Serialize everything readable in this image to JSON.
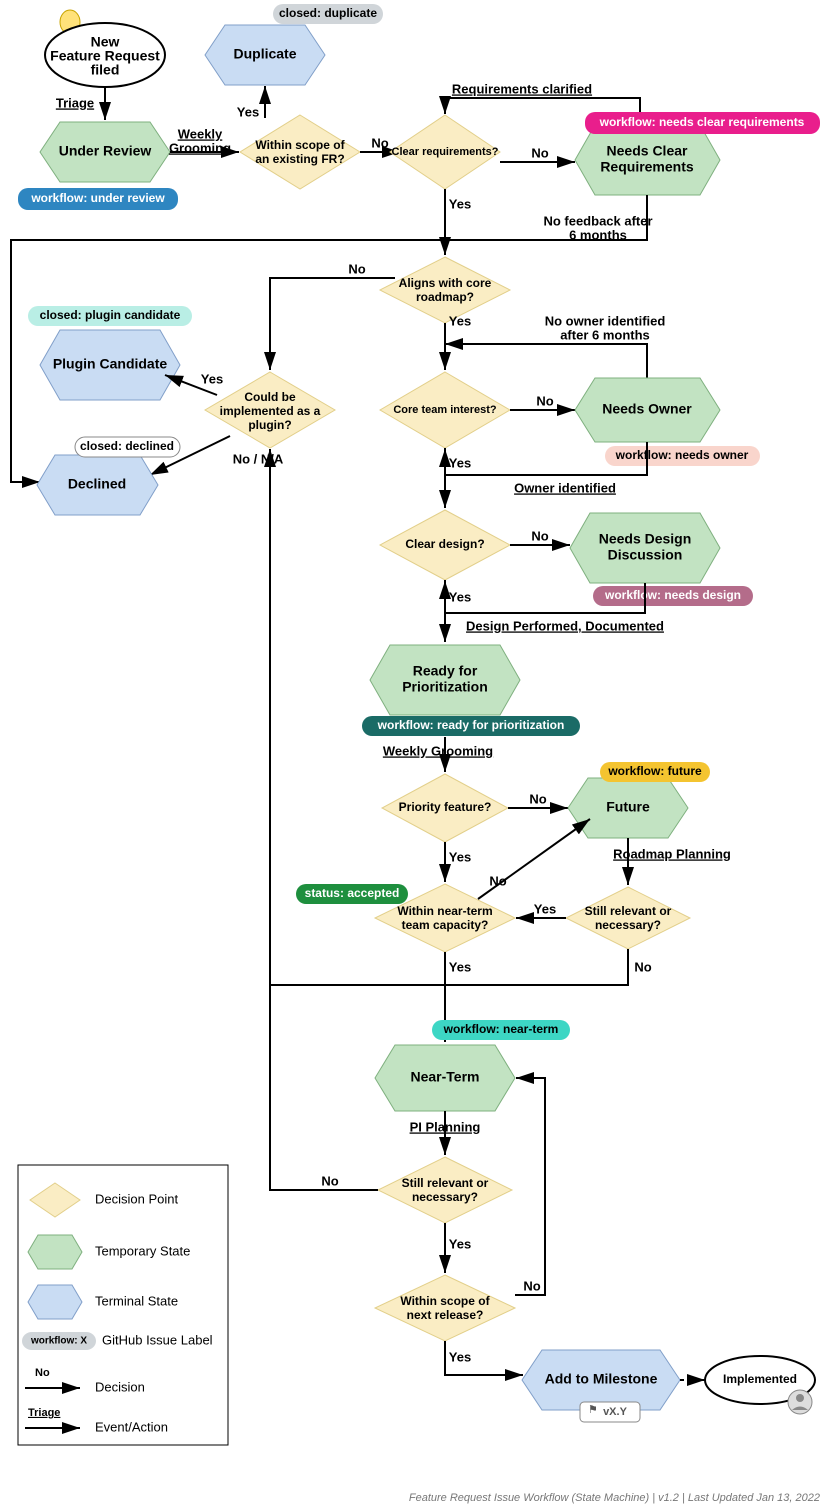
{
  "meta": {
    "title": "Feature Request Issue Workflow (State Machine)",
    "version": "v1.2",
    "last_updated": "Last Updated Jan 13, 2022",
    "footer_combined": "Feature Request Issue Workflow (State Machine) | v1.2 | Last Updated Jan 13, 2022"
  },
  "nodes": {
    "start": {
      "label_l1": "New",
      "label_l2": "Feature Request",
      "label_l3": "filed"
    },
    "under_review": {
      "label_l1": "Under Review"
    },
    "duplicate": {
      "label_l1": "Duplicate"
    },
    "within_scope_fr": {
      "label_l1": "Within scope of",
      "label_l2": "an existing FR?"
    },
    "clear_requirements": {
      "label_l1": "Clear requirements?"
    },
    "needs_clear_req": {
      "label_l1": "Needs Clear",
      "label_l2": "Requirements"
    },
    "aligns_roadmap": {
      "label_l1": "Aligns with core",
      "label_l2": "roadmap?"
    },
    "plugin_candidate": {
      "label_l1": "Plugin Candidate"
    },
    "could_plugin": {
      "label_l1": "Could be",
      "label_l2": "implemented as a",
      "label_l3": "plugin?"
    },
    "declined": {
      "label_l1": "Declined"
    },
    "core_team_interest": {
      "label_l1": "Core team interest?"
    },
    "needs_owner": {
      "label_l1": "Needs Owner"
    },
    "clear_design": {
      "label_l1": "Clear design?"
    },
    "needs_design": {
      "label_l1": "Needs Design",
      "label_l2": "Discussion"
    },
    "ready_prioritization": {
      "label_l1": "Ready for",
      "label_l2": "Prioritization"
    },
    "priority_feature": {
      "label_l1": "Priority feature?"
    },
    "future": {
      "label_l1": "Future"
    },
    "within_capacity": {
      "label_l1": "Within near-term",
      "label_l2": "team capacity?"
    },
    "still_relevant_1": {
      "label_l1": "Still relevant or",
      "label_l2": "necessary?"
    },
    "near_term": {
      "label_l1": "Near-Term"
    },
    "still_relevant_2": {
      "label_l1": "Still relevant or",
      "label_l2": "necessary?"
    },
    "within_next_release": {
      "label_l1": "Within scope of",
      "label_l2": "next release?"
    },
    "add_milestone": {
      "label_l1": "Add to Milestone"
    },
    "implemented": {
      "label_l1": "Implemented"
    },
    "milestone_tag": {
      "label_l1": "vX.Y"
    }
  },
  "badges": {
    "under_review": "workflow: under review",
    "closed_duplicate": "closed: duplicate",
    "needs_clear_req": "workflow: needs clear requirements",
    "plugin_candidate": "closed: plugin candidate",
    "closed_declined": "closed: declined",
    "needs_owner": "workflow: needs owner",
    "needs_design": "workflow: needs design",
    "ready_prioritization": "workflow: ready for prioritization",
    "future": "workflow: future",
    "status_accepted": "status: accepted",
    "near_term": "workflow: near-term"
  },
  "edges": {
    "triage": "Triage",
    "weekly_grooming_1": "Weekly",
    "weekly_grooming_1b": "Grooming",
    "yes": "Yes",
    "no": "No",
    "requirements_clarified": "Requirements clarified",
    "no_feedback_6mo": "No feedback after",
    "no_feedback_6mo_b": "6 months",
    "no_owner_6mo": "No owner identified",
    "no_owner_6mo_b": "after 6 months",
    "owner_identified": "Owner identified",
    "design_performed": "Design Performed, Documented",
    "weekly_grooming_2": "Weekly Grooming",
    "roadmap_planning": "Roadmap Planning",
    "pi_planning": "PI Planning",
    "no_na": "No / N/A"
  },
  "legend": {
    "decision_point": "Decision Point",
    "temporary_state": "Temporary State",
    "terminal_state": "Terminal State",
    "github_label": "GitHub Issue Label",
    "decision_arrow": "Decision",
    "event_arrow": "Event/Action",
    "workflow_x": "workflow: X",
    "no_underlined": "No",
    "triage_underlined": "Triage"
  },
  "chart_data": {
    "type": "flowchart",
    "title": "Feature Request Issue Workflow (State Machine)",
    "version": "v1.2",
    "date": "Jan 13, 2022",
    "node_types": {
      "start": "start-ellipse",
      "end": "end-ellipse",
      "decision": "diamond",
      "temporary_state": "hexagon-green",
      "terminal_state": "hexagon-blue"
    },
    "nodes": [
      {
        "id": "start",
        "type": "start",
        "label": "New Feature Request filed"
      },
      {
        "id": "under_review",
        "type": "temporary_state",
        "label": "Under Review",
        "badge": "workflow: under review",
        "badge_color": "#2e86c1"
      },
      {
        "id": "duplicate",
        "type": "terminal_state",
        "label": "Duplicate",
        "badge": "closed: duplicate",
        "badge_color": "#d0d5d9"
      },
      {
        "id": "within_scope_fr",
        "type": "decision",
        "label": "Within scope of an existing FR?"
      },
      {
        "id": "clear_requirements",
        "type": "decision",
        "label": "Clear requirements?"
      },
      {
        "id": "needs_clear_req",
        "type": "temporary_state",
        "label": "Needs Clear Requirements",
        "badge": "workflow: needs clear requirements",
        "badge_color": "#e91e8c"
      },
      {
        "id": "aligns_roadmap",
        "type": "decision",
        "label": "Aligns with core roadmap?"
      },
      {
        "id": "plugin_candidate",
        "type": "terminal_state",
        "label": "Plugin Candidate",
        "badge": "closed: plugin candidate",
        "badge_color": "#b9eee5"
      },
      {
        "id": "could_plugin",
        "type": "decision",
        "label": "Could be implemented as a plugin?"
      },
      {
        "id": "declined",
        "type": "terminal_state",
        "label": "Declined",
        "badge": "closed: declined",
        "badge_color": "#ffffff"
      },
      {
        "id": "core_team_interest",
        "type": "decision",
        "label": "Core team interest?"
      },
      {
        "id": "needs_owner",
        "type": "temporary_state",
        "label": "Needs Owner",
        "badge": "workflow: needs owner",
        "badge_color": "#f9d5cc"
      },
      {
        "id": "clear_design",
        "type": "decision",
        "label": "Clear design?"
      },
      {
        "id": "needs_design",
        "type": "temporary_state",
        "label": "Needs Design Discussion",
        "badge": "workflow: needs design",
        "badge_color": "#b46c8a"
      },
      {
        "id": "ready_prioritization",
        "type": "temporary_state",
        "label": "Ready for Prioritization",
        "badge": "workflow: ready for prioritization",
        "badge_color": "#1a6b66"
      },
      {
        "id": "priority_feature",
        "type": "decision",
        "label": "Priority feature?"
      },
      {
        "id": "future",
        "type": "temporary_state",
        "label": "Future",
        "badge": "workflow: future",
        "badge_color": "#f4c430"
      },
      {
        "id": "within_capacity",
        "type": "decision",
        "label": "Within near-term team capacity?",
        "badge": "status: accepted",
        "badge_color": "#1e8f3e"
      },
      {
        "id": "still_relevant_1",
        "type": "decision",
        "label": "Still relevant or necessary?"
      },
      {
        "id": "near_term",
        "type": "temporary_state",
        "label": "Near-Term",
        "badge": "workflow: near-term",
        "badge_color": "#3dd6c4"
      },
      {
        "id": "still_relevant_2",
        "type": "decision",
        "label": "Still relevant or necessary?"
      },
      {
        "id": "within_next_release",
        "type": "decision",
        "label": "Within scope of next release?"
      },
      {
        "id": "add_milestone",
        "type": "terminal_state",
        "label": "Add to Milestone",
        "milestone_tag": "vX.Y"
      },
      {
        "id": "implemented",
        "type": "end",
        "label": "Implemented"
      }
    ],
    "edges": [
      {
        "from": "start",
        "to": "under_review",
        "label": "Triage"
      },
      {
        "from": "under_review",
        "to": "within_scope_fr",
        "label": "Weekly Grooming"
      },
      {
        "from": "within_scope_fr",
        "to": "duplicate",
        "label": "Yes"
      },
      {
        "from": "within_scope_fr",
        "to": "clear_requirements",
        "label": "No"
      },
      {
        "from": "clear_requirements",
        "to": "needs_clear_req",
        "label": "No"
      },
      {
        "from": "needs_clear_req",
        "to": "clear_requirements",
        "label": "Requirements clarified"
      },
      {
        "from": "needs_clear_req",
        "to": "declined",
        "label": "No feedback after 6 months"
      },
      {
        "from": "clear_requirements",
        "to": "aligns_roadmap",
        "label": "Yes"
      },
      {
        "from": "aligns_roadmap",
        "to": "could_plugin",
        "label": "No"
      },
      {
        "from": "aligns_roadmap",
        "to": "core_team_interest",
        "label": "Yes"
      },
      {
        "from": "could_plugin",
        "to": "plugin_candidate",
        "label": "Yes"
      },
      {
        "from": "could_plugin",
        "to": "declined",
        "label": "No / N/A"
      },
      {
        "from": "core_team_interest",
        "to": "needs_owner",
        "label": "No"
      },
      {
        "from": "needs_owner",
        "to": "core_team_interest",
        "label": "Owner identified"
      },
      {
        "from": "needs_owner",
        "to": "aligns_roadmap",
        "label": "No owner identified after 6 months"
      },
      {
        "from": "core_team_interest",
        "to": "clear_design",
        "label": "Yes"
      },
      {
        "from": "clear_design",
        "to": "needs_design",
        "label": "No"
      },
      {
        "from": "needs_design",
        "to": "clear_design",
        "label": "Design Performed, Documented"
      },
      {
        "from": "clear_design",
        "to": "ready_prioritization",
        "label": "Yes"
      },
      {
        "from": "ready_prioritization",
        "to": "priority_feature",
        "label": "Weekly Grooming"
      },
      {
        "from": "priority_feature",
        "to": "future",
        "label": "No"
      },
      {
        "from": "priority_feature",
        "to": "within_capacity",
        "label": "Yes"
      },
      {
        "from": "future",
        "to": "still_relevant_1",
        "label": "Roadmap Planning"
      },
      {
        "from": "still_relevant_1",
        "to": "within_capacity",
        "label": "Yes"
      },
      {
        "from": "still_relevant_1",
        "to": "could_plugin",
        "label": "No"
      },
      {
        "from": "within_capacity",
        "to": "future",
        "label": "No"
      },
      {
        "from": "within_capacity",
        "to": "near_term",
        "label": "Yes"
      },
      {
        "from": "near_term",
        "to": "still_relevant_2",
        "label": "PI Planning"
      },
      {
        "from": "still_relevant_2",
        "to": "within_next_release",
        "label": "Yes"
      },
      {
        "from": "still_relevant_2",
        "to": "could_plugin",
        "label": "No"
      },
      {
        "from": "within_next_release",
        "to": "add_milestone",
        "label": "Yes"
      },
      {
        "from": "within_next_release",
        "to": "near_term",
        "label": "No"
      },
      {
        "from": "add_milestone",
        "to": "implemented",
        "label": ""
      }
    ],
    "legend": [
      {
        "shape": "diamond",
        "label": "Decision Point"
      },
      {
        "shape": "hexagon-green",
        "label": "Temporary State"
      },
      {
        "shape": "hexagon-blue",
        "label": "Terminal State"
      },
      {
        "shape": "badge",
        "label": "GitHub Issue Label",
        "example": "workflow: X"
      },
      {
        "shape": "arrow",
        "underlined_tag": "No",
        "label": "Decision"
      },
      {
        "shape": "arrow",
        "underlined_tag": "Triage",
        "label": "Event/Action"
      }
    ]
  }
}
